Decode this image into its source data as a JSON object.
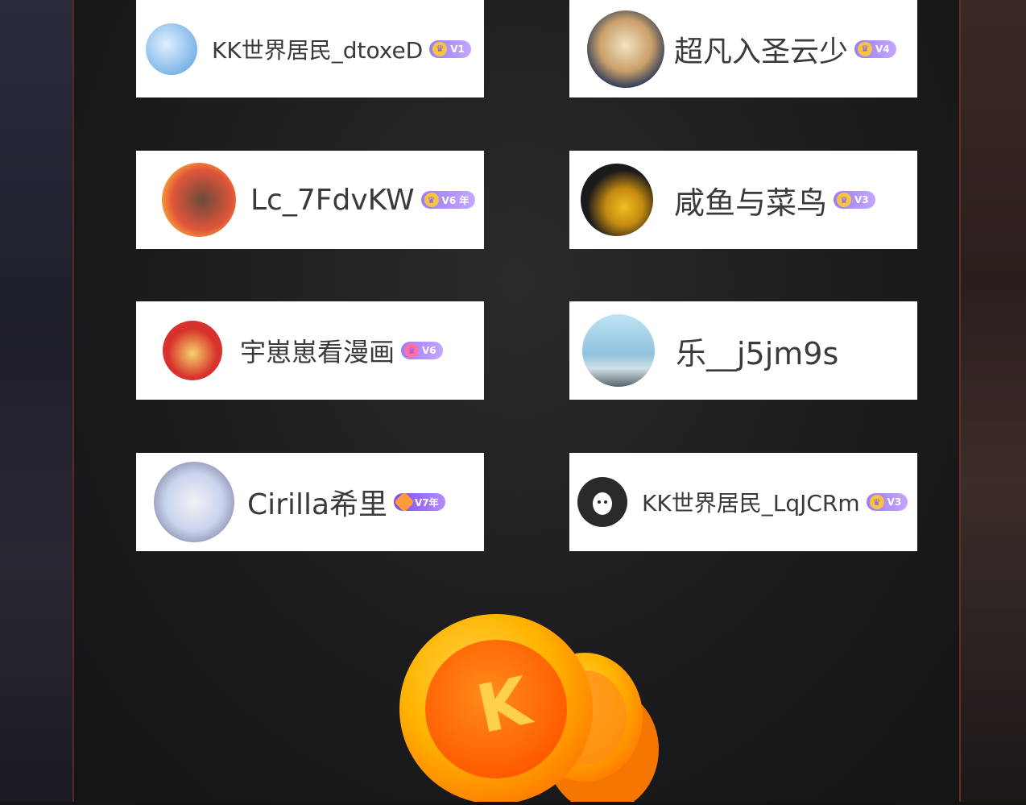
{
  "users": [
    {
      "name": "KK世界居民_dtoxeD",
      "badge": "V1",
      "avatar": "anime-girl-blue-hair",
      "color": "#7fb6e8"
    },
    {
      "name": "超凡入圣云少",
      "badge": "V4",
      "avatar": "anime-boy-scroll",
      "color": "#2b3a5a"
    },
    {
      "name": "Lc_7FdvKW",
      "badge": "V6 年",
      "avatar": "reading-day-book",
      "color": "#e0553a"
    },
    {
      "name": "咸鱼与菜鸟",
      "badge": "V3",
      "avatar": "yang-calligraphy-flowers",
      "color": "#1b1b1b"
    },
    {
      "name": "宇崽崽看漫画",
      "badge": "V6",
      "avatar": "god-of-wealth",
      "color": "#d8322c"
    },
    {
      "name": "乐__j5jm9s",
      "badge": "",
      "avatar": "sky-photo",
      "color": "#8fc3df"
    },
    {
      "name": "Cirilla希里",
      "badge": "V7年",
      "avatar": "anime-white-hair-group",
      "color": "#c9d4ee"
    },
    {
      "name": "KK世界居民_LqJCRm",
      "badge": "V3",
      "avatar": "default-ghost",
      "color": "#2a2a2a"
    }
  ],
  "coin": {
    "label": "K",
    "colors": [
      "#ffb300",
      "#ff6a00"
    ]
  }
}
